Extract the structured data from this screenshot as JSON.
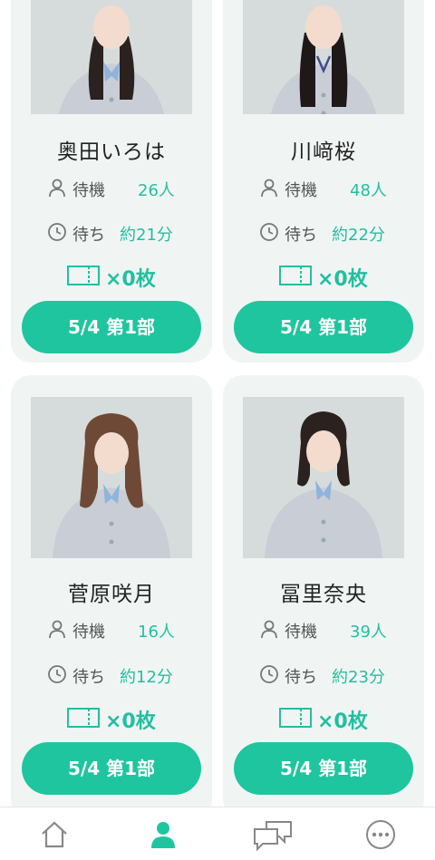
{
  "cards": [
    {
      "name": "奥田いろは",
      "wait_label": "待機",
      "wait_count": "26人",
      "time_label": "待ち",
      "time_value": "約21分",
      "tickets": "×0枚",
      "button": "5/4 第1部"
    },
    {
      "name": "川﨑桜",
      "wait_label": "待機",
      "wait_count": "48人",
      "time_label": "待ち",
      "time_value": "約22分",
      "tickets": "×0枚",
      "button": "5/4 第1部"
    },
    {
      "name": "菅原咲月",
      "wait_label": "待機",
      "wait_count": "16人",
      "time_label": "待ち",
      "time_value": "約12分",
      "tickets": "×0枚",
      "button": "5/4 第1部"
    },
    {
      "name": "冨里奈央",
      "wait_label": "待機",
      "wait_count": "39人",
      "time_label": "待ち",
      "time_value": "約23分",
      "tickets": "×0枚",
      "button": "5/4 第1部"
    }
  ],
  "tabbar": {
    "items": [
      {
        "icon": "home-icon",
        "active": false
      },
      {
        "icon": "person-icon",
        "active": true
      },
      {
        "icon": "chat-icon",
        "active": false
      },
      {
        "icon": "more-icon",
        "active": false
      }
    ]
  },
  "colors": {
    "accent": "#1fc59e",
    "accent_text": "#22bfa0",
    "card_bg": "#f0f5f4",
    "inactive_icon": "#888888"
  }
}
